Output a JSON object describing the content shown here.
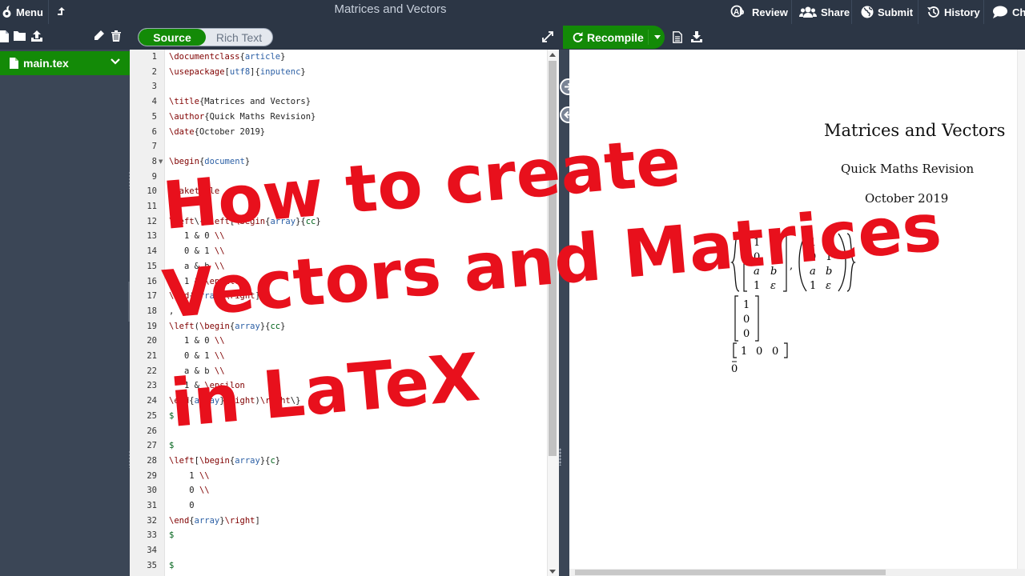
{
  "topbar": {
    "menu_label": "Menu",
    "title": "Matrices and Vectors",
    "review_label": "Review",
    "share_label": "Share",
    "submit_label": "Submit",
    "history_label": "History",
    "chat_label": "Cha"
  },
  "editor_toolbar": {
    "source_label": "Source",
    "richtext_label": "Rich Text"
  },
  "pdf_toolbar": {
    "recompile_label": "Recompile"
  },
  "file_tree": {
    "files": [
      {
        "name": "main.tex",
        "selected": true
      }
    ]
  },
  "editor": {
    "line_numbers": [
      "1",
      "2",
      "3",
      "4",
      "5",
      "6",
      "7",
      "8",
      "9",
      "10",
      "11",
      "12",
      "13",
      "14",
      "15",
      "16",
      "17",
      "18",
      "19",
      "20",
      "21",
      "22",
      "23",
      "24",
      "25",
      "26",
      "27",
      "28",
      "29",
      "30",
      "31",
      "32",
      "33",
      "34",
      "35"
    ],
    "fold_lines": [
      "8"
    ],
    "lines": [
      "\\documentclass{article}",
      "\\usepackage[utf8]{inputenc}",
      "",
      "\\title{Matrices and Vectors}",
      "\\author{Quick Maths Revision}",
      "\\date{October 2019}",
      "",
      "\\begin{document}",
      "",
      "\\maketitle",
      "",
      "\\left\\{\\left[\\begin{array}{cc}",
      "   1 & 0 \\\\",
      "   0 & 1 \\\\",
      "   a & b \\\\",
      "   1 & \\epsilon",
      "\\end{array}\\right]",
      ",",
      "\\left(\\begin{array}{cc}",
      "   1 & 0 \\\\",
      "   0 & 1 \\\\",
      "   a & b \\\\",
      "   1 & \\epsilon",
      "\\end{array}\\right)\\right\\}",
      "$",
      "",
      "$",
      "\\left[\\begin{array}{c}",
      "    1 \\\\",
      "    0 \\\\",
      "    0",
      "\\end{array}\\right]",
      "$",
      "",
      "$"
    ]
  },
  "pdf": {
    "title": "Matrices and Vectors",
    "author": "Quick Maths Revision",
    "date": "October 2019",
    "matrix_a": [
      [
        "1",
        "0"
      ],
      [
        "0",
        "1"
      ],
      [
        "a",
        "b"
      ],
      [
        "1",
        "ε"
      ]
    ],
    "matrix_b": [
      [
        "1",
        "0"
      ],
      [
        "0",
        "1"
      ],
      [
        "a",
        "b"
      ],
      [
        "1",
        "ε"
      ]
    ],
    "column_vector": [
      "1",
      "0",
      "0"
    ],
    "row_vector": [
      "1",
      "0",
      "0"
    ],
    "zero_vector": "0",
    "comma": ","
  },
  "overlay": {
    "line1": "How to create",
    "line2": "Vectors and Matrices",
    "line3": "in LaTeX",
    "color": "#e8101c"
  },
  "colors": {
    "topbar_bg": "#2c3645",
    "sidebar_bg": "#3b4656",
    "accent_green": "#138a07"
  }
}
